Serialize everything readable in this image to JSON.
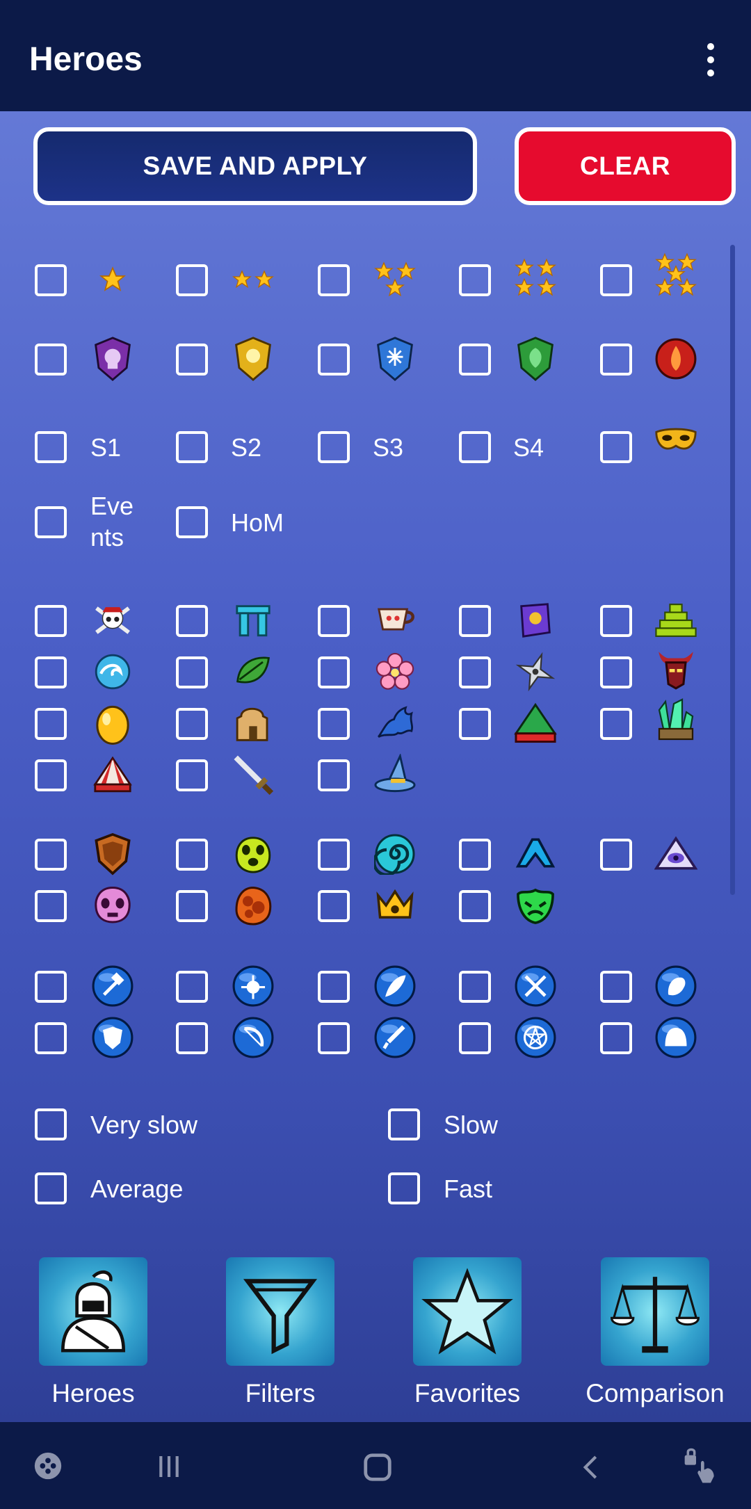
{
  "header": {
    "title": "Heroes",
    "menu_icon": "more-vert-icon"
  },
  "actions": {
    "save_label": "SAVE AND APPLY",
    "clear_label": "CLEAR"
  },
  "filters": {
    "stars": [
      "1-star-icon",
      "2-star-icon",
      "3-star-icon",
      "4-star-icon",
      "5-star-icon"
    ],
    "colors": [
      "dark-shield-icon",
      "holy-shield-icon",
      "ice-shield-icon",
      "nature-shield-icon",
      "fire-shield-icon"
    ],
    "seasons": [
      "S1",
      "S2",
      "S3",
      "S4",
      "mask-icon"
    ],
    "origins": [
      "Events",
      "HoM"
    ],
    "families": [
      "pirate-icon",
      "stonehenge-icon",
      "teacup-icon",
      "grimoire-icon",
      "pyramid-icon",
      "wave-icon",
      "leaf-icon",
      "flower-icon",
      "shuriken-icon",
      "demon-icon",
      "egg-icon",
      "castle-icon",
      "bat-icon",
      "tent-icon",
      "crystal-icon",
      "circus-icon",
      "sword-icon",
      "wizard-hat-icon"
    ],
    "classes": [
      "paladin-class-icon",
      "druid-class-icon",
      "sorcerer-class-icon",
      "fighter-class-icon",
      "monk-class-icon",
      "necro-class-icon",
      "rogue-class-icon",
      "barbarian-class-icon",
      "cleric-class-icon"
    ],
    "skills": [
      "hammer-skill-icon",
      "bomb-skill-icon",
      "feather-skill-icon",
      "crossed-swords-skill-icon",
      "hand-skill-icon",
      "shield-skill-icon",
      "bow-skill-icon",
      "dagger-skill-icon",
      "pentagram-skill-icon",
      "helmet-skill-icon"
    ],
    "speeds": [
      "Very slow",
      "Slow",
      "Average",
      "Fast"
    ]
  },
  "bottom_tabs": [
    "Heroes",
    "Filters",
    "Favorites",
    "Comparison"
  ],
  "tab_icons": [
    "knight-icon",
    "funnel-icon",
    "star-icon",
    "scales-icon"
  ],
  "system_nav": [
    "game-launcher-icon",
    "recents-icon",
    "home-icon",
    "back-icon",
    "accessibility-icon"
  ],
  "colors": {
    "appbar": "#0c1a48",
    "clear": "#e60b2e",
    "save": "#1d3288"
  }
}
